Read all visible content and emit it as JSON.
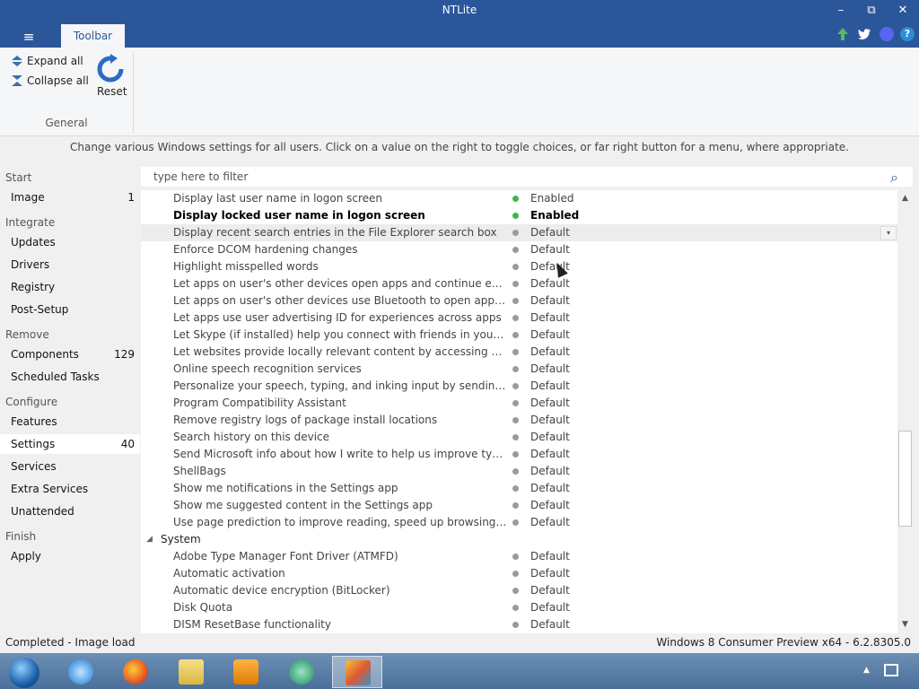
{
  "window": {
    "title": "NTLite",
    "minimize": "–",
    "restore": "⧉",
    "close": "✕"
  },
  "ribbon": {
    "menu_icon": "≡",
    "tab": "Toolbar",
    "expand_all": "Expand all",
    "collapse_all": "Collapse all",
    "reset": "Reset",
    "group": "General"
  },
  "title_icons": [
    "update-arrow-icon",
    "twitter-icon",
    "discord-icon",
    "help-icon"
  ],
  "info_text": "Change various Windows settings for all users. Click on a value on the right to toggle choices, or far right button for a menu, where appropriate.",
  "sidebar": {
    "sections": [
      {
        "title": "Start",
        "items": [
          {
            "label": "Image",
            "count": "1"
          }
        ]
      },
      {
        "title": "Integrate",
        "items": [
          {
            "label": "Updates",
            "count": ""
          },
          {
            "label": "Drivers",
            "count": ""
          },
          {
            "label": "Registry",
            "count": ""
          },
          {
            "label": "Post-Setup",
            "count": ""
          }
        ]
      },
      {
        "title": "Remove",
        "items": [
          {
            "label": "Components",
            "count": "129"
          },
          {
            "label": "Scheduled Tasks",
            "count": ""
          }
        ]
      },
      {
        "title": "Configure",
        "items": [
          {
            "label": "Features",
            "count": ""
          },
          {
            "label": "Settings",
            "count": "40"
          },
          {
            "label": "Services",
            "count": ""
          },
          {
            "label": "Extra Services",
            "count": ""
          },
          {
            "label": "Unattended",
            "count": ""
          }
        ]
      },
      {
        "title": "Finish",
        "items": [
          {
            "label": "Apply",
            "count": ""
          }
        ]
      }
    ]
  },
  "filter": {
    "placeholder": "type here to filter",
    "icon": "⌕"
  },
  "settings_rows": [
    {
      "name": "Display last user name in logon screen",
      "value": "Enabled",
      "state": "on"
    },
    {
      "name": "Display locked user name in logon screen",
      "value": "Enabled",
      "state": "on",
      "bold": true
    },
    {
      "name": "Display recent search entries in the File Explorer search box",
      "value": "Default",
      "state": "off",
      "highlight": true
    },
    {
      "name": "Enforce DCOM hardening changes",
      "value": "Default",
      "state": "off"
    },
    {
      "name": "Highlight misspelled words",
      "value": "Default",
      "state": "off"
    },
    {
      "name": "Let apps on user's other devices open apps and continue experience...",
      "value": "Default",
      "state": "off"
    },
    {
      "name": "Let apps on user's other devices use Bluetooth to open apps and con...",
      "value": "Default",
      "state": "off"
    },
    {
      "name": "Let apps use user advertising ID for experiences across apps",
      "value": "Default",
      "state": "off"
    },
    {
      "name": "Let Skype (if installed) help you connect with friends in your address ...",
      "value": "Default",
      "state": "off"
    },
    {
      "name": "Let websites provide locally relevant content by accessing user langu...",
      "value": "Default",
      "state": "off"
    },
    {
      "name": "Online speech recognition services",
      "value": "Default",
      "state": "off"
    },
    {
      "name": "Personalize your speech, typing, and inking input by sending your in...",
      "value": "Default",
      "state": "off"
    },
    {
      "name": "Program Compatibility Assistant",
      "value": "Default",
      "state": "off"
    },
    {
      "name": "Remove registry logs of package install locations",
      "value": "Default",
      "state": "off"
    },
    {
      "name": "Search history on this device",
      "value": "Default",
      "state": "off"
    },
    {
      "name": "Send Microsoft info about how I write to help us improve typing and...",
      "value": "Default",
      "state": "off"
    },
    {
      "name": "ShellBags",
      "value": "Default",
      "state": "off"
    },
    {
      "name": "Show me notifications in the Settings app",
      "value": "Default",
      "state": "off"
    },
    {
      "name": "Show me suggested content in the Settings app",
      "value": "Default",
      "state": "off"
    },
    {
      "name": "Use page prediction to improve reading, speed up browsing. Your br...",
      "value": "Default",
      "state": "off"
    },
    {
      "group": "System",
      "expander": "◢"
    },
    {
      "name": "Adobe Type Manager Font Driver (ATMFD)",
      "value": "Default",
      "state": "off"
    },
    {
      "name": "Automatic activation",
      "value": "Default",
      "state": "off"
    },
    {
      "name": "Automatic device encryption (BitLocker)",
      "value": "Default",
      "state": "off"
    },
    {
      "name": "Disk Quota",
      "value": "Default",
      "state": "off"
    },
    {
      "name": "DISM ResetBase functionality",
      "value": "Default",
      "state": "off"
    }
  ],
  "row_menu_glyph": "▾",
  "scroll": {
    "up": "▲",
    "down": "▼"
  },
  "status": {
    "left": "Completed - Image load",
    "right": "Windows 8 Consumer Preview x64 - 6.2.8305.0"
  },
  "taskbar": {
    "apps": [
      "start-orb-icon",
      "internet-explorer-icon",
      "firefox-icon",
      "file-explorer-icon",
      "media-player-icon",
      "bluetooth-app-icon",
      "ntlite-icon"
    ],
    "tray_up": "▲"
  },
  "colors": {
    "accent": "#2b579a",
    "enabled_dot": "#3fb54a",
    "default_dot": "#9a9a9a"
  }
}
